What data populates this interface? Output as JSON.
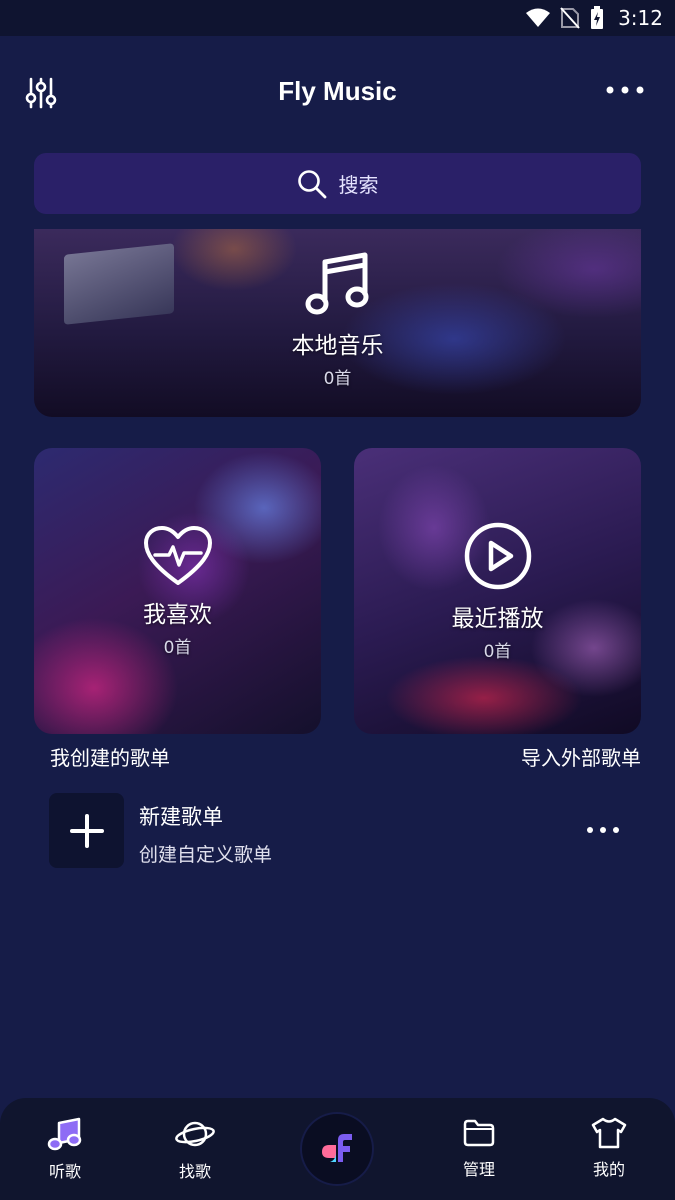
{
  "status_bar": {
    "time": "3:12"
  },
  "header": {
    "title": "Fly Music"
  },
  "search": {
    "placeholder": "搜索"
  },
  "cards": {
    "local": {
      "title": "本地音乐",
      "count": "0首"
    },
    "favorites": {
      "title": "我喜欢",
      "count": "0首"
    },
    "recent": {
      "title": "最近播放",
      "count": "0首"
    }
  },
  "playlists": {
    "my_created_label": "我创建的歌单",
    "import_label": "导入外部歌单",
    "new_item": {
      "name": "新建歌单",
      "desc": "创建自定义歌单"
    }
  },
  "bottom_nav": {
    "listen": "听歌",
    "find": "找歌",
    "manage": "管理",
    "mine": "我的"
  },
  "colors": {
    "background": "#161c48",
    "search_bg": "#2a2068",
    "accent": "#8e6cf5"
  }
}
